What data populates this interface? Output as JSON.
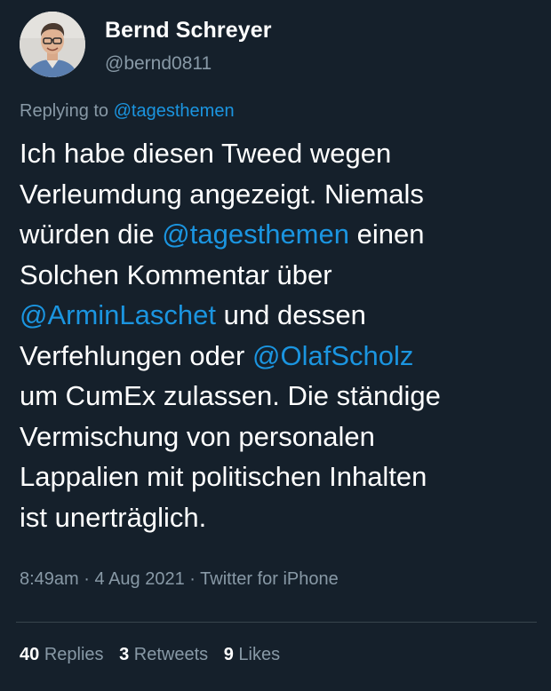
{
  "author": {
    "display_name": "Bernd Schreyer",
    "handle": "@bernd0811"
  },
  "reply": {
    "prefix": "Replying to",
    "to": "@tagesthemen"
  },
  "tweet": {
    "line1": "Ich habe diesen Tweed wegen",
    "line2": "Verleumdung angezeigt. Niemals",
    "line3_a": "würden die ",
    "line3_mention": "@tagesthemen",
    "line3_b": " einen",
    "line4": "Solchen Kommentar über",
    "line5_mention": "@ArminLaschet",
    "line5_b": " und dessen",
    "line6_a": "Verfehlungen oder ",
    "line6_mention": "@OlafScholz",
    "line7": "um CumEx zulassen. Die ständige",
    "line8": "Vermischung von personalen",
    "line9": "Lappalien mit politischen Inhalten",
    "line10": "ist unerträglich."
  },
  "meta": {
    "time": "8:49am",
    "separator": " · ",
    "date": "4 Aug 2021",
    "source": "Twitter for iPhone"
  },
  "stats": {
    "replies_count": "40",
    "replies_label": "Replies",
    "retweets_count": "3",
    "retweets_label": "Retweets",
    "likes_count": "9",
    "likes_label": "Likes"
  },
  "colors": {
    "background": "#15202b",
    "text": "#ffffff",
    "secondary": "#8899a6",
    "link": "#1b95e0",
    "divider": "#38444d"
  },
  "icons": {
    "avatar": "profile-photo"
  }
}
